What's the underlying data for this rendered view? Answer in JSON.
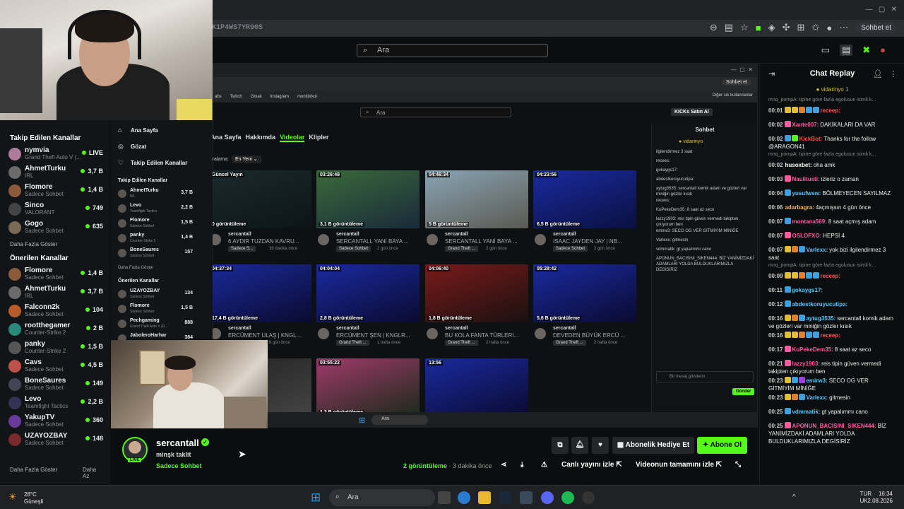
{
  "browser": {
    "url": "K1P4WS7YR90S",
    "chat_button": "Sohbet et"
  },
  "header": {
    "search_placeholder": "Ara"
  },
  "sidebar": {
    "followed_title": "Takip Edilen Kanallar",
    "followed": [
      {
        "name": "nymvia",
        "category": "Grand Theft Auto V (...",
        "viewers": "LIVE",
        "color": "#b07a9a"
      },
      {
        "name": "AhmetTurku",
        "category": "IRL",
        "viewers": "3,7 B",
        "color": "#6a6a6a"
      },
      {
        "name": "Flomore",
        "category": "Sadece Sohbet",
        "viewers": "1,4 B",
        "color": "#8a5a3a"
      },
      {
        "name": "Sinco",
        "category": "VALORANT",
        "viewers": "749",
        "color": "#444"
      },
      {
        "name": "Gogo",
        "category": "Sadece Sohbet",
        "viewers": "635",
        "color": "#7a6a55"
      }
    ],
    "followed_more": "Daha Fazla Göster",
    "recommended_title": "Önerilen Kanallar",
    "recommended": [
      {
        "name": "Flomore",
        "category": "Sadece Sohbet",
        "viewers": "1,4 B",
        "color": "#8a5a3a"
      },
      {
        "name": "AhmetTurku",
        "category": "IRL",
        "viewers": "3,7 B",
        "color": "#6a6a6a"
      },
      {
        "name": "Falconn2k",
        "category": "Sadece Sohbet",
        "viewers": "104",
        "color": "#b85a2a"
      },
      {
        "name": "rootthegamer",
        "category": "Counter-Strike 2",
        "viewers": "2 B",
        "color": "#2a8a7a"
      },
      {
        "name": "panky",
        "category": "Counter-Strike 2",
        "viewers": "1,5 B",
        "color": "#555"
      },
      {
        "name": "Cavs",
        "category": "Sadece Sohbet",
        "viewers": "4,5 B",
        "color": "#c0504a"
      },
      {
        "name": "BoneSaures",
        "category": "Sadece Sohbet",
        "viewers": "149",
        "color": "#445"
      },
      {
        "name": "Levo",
        "category": "Teamfight Tactics",
        "viewers": "2,2 B",
        "color": "#335"
      },
      {
        "name": "YakupTV",
        "category": "Sadece Sohbet",
        "viewers": "360",
        "color": "#6a3a9a"
      },
      {
        "name": "UZAYOZBAY",
        "category": "Sadece Sohbet",
        "viewers": "148",
        "color": "#7a2a2a"
      }
    ],
    "more": "Daha Fazla Göster",
    "less": "Daha Az"
  },
  "inner": {
    "nav": [
      "Ana Sayfa",
      "Gözat",
      "Takip Edilen Kanallar"
    ],
    "followed_title": "Takip Edilen Kanallar",
    "followed": [
      {
        "name": "AhmetTurku",
        "category": "IRL",
        "viewers": "3,7 B"
      },
      {
        "name": "Levo",
        "category": "Teamfight Tactics",
        "viewers": "2,2 B"
      },
      {
        "name": "Flomore",
        "category": "Sadece Sohbet",
        "viewers": "1,5 B"
      },
      {
        "name": "panky",
        "category": "Counter-Strike 2",
        "viewers": "1,4 B"
      },
      {
        "name": "BoneSaures",
        "category": "Sadece Sohbet",
        "viewers": "157"
      }
    ],
    "followed_more": "Daha Fazla Göster",
    "recommended_title": "Önerilen Kanallar",
    "recommended": [
      {
        "name": "UZAYOZBAY",
        "category": "Sadece Sohbet",
        "viewers": "134"
      },
      {
        "name": "Flomore",
        "category": "Sadece Sohbet",
        "viewers": "1,5 B"
      },
      {
        "name": "Pechgaming",
        "category": "Grand Theft Auto V (R...",
        "viewers": "888"
      },
      {
        "name": "JaboleroHarhar",
        "category": "",
        "viewers": "384"
      }
    ],
    "bookmarks": [
      "abs",
      "Twitch",
      "Gmail",
      "Instagram",
      "monitörkol"
    ],
    "other_bookmarks": "Diğer sık kullanılanlar",
    "search_placeholder": "Ara",
    "buy_kicks": "KICKs Satın Al",
    "tabs": [
      "Ana Sayfa",
      "Hakkımda",
      "Videolar",
      "Klipler"
    ],
    "sort_label": "Sıralama:",
    "sort_value": "En Yeni",
    "videos": [
      {
        "duration": "Güncel Yayın",
        "views": "0 görüntüleme",
        "channel": "sercantall",
        "title": "6 AYDIR TUZDAN KAVRU...",
        "tag": "Sadece S...",
        "ago": "38 dakika önce",
        "c1": "#1a2a2e",
        "c2": "#0d1417"
      },
      {
        "duration": "03:26:48",
        "views": "3,1 B görüntüleme",
        "channel": "sercantall",
        "title": "SERCANTALL YANİ BAYA ...",
        "tag": "Sadece Sohbet",
        "ago": "2 gün önce",
        "c1": "#3a6a3a",
        "c2": "#1a2a3a"
      },
      {
        "duration": "04:46:34",
        "views": "5 B görüntüleme",
        "channel": "sercantall",
        "title": "SERCANTALL YANİ BAYA ...",
        "tag": "Grand Theft ...",
        "ago": "2 gün önce",
        "c1": "#8aa4b4",
        "c2": "#5a5a52"
      },
      {
        "duration": "04:23:56",
        "views": "6,5 B görüntüleme",
        "channel": "sercantall",
        "title": "ISAAC JAYDEN JAY | NB...",
        "tag": "Sadece Sohbet",
        "ago": "2 gün önce",
        "c1": "#1a2aa0",
        "c2": "#0a1040"
      },
      {
        "duration": "04:37:34",
        "views": "17,4 B görüntüleme",
        "channel": "sercantall",
        "title": "ERCÜMENT ULAŞ | KNGL...",
        "tag": "",
        "ago": "6 gün önce",
        "c1": "#1a2a9a",
        "c2": "#0a0a30"
      },
      {
        "duration": "04:04:04",
        "views": "2,8 B görüntüleme",
        "channel": "sercantall",
        "title": "ERCÜMENT ŞEN | KNGLR...",
        "tag": "Grand Theft ...",
        "ago": "1 hafta önce",
        "c1": "#1a2aa0",
        "c2": "#0a0a30"
      },
      {
        "duration": "04:06:40",
        "views": "1,8 B görüntüleme",
        "channel": "sercantall",
        "title": "BU KOLA FANTA TÜRLERİ...",
        "tag": "Grand Theft ...",
        "ago": "2 hafta önce",
        "c1": "#7a1a1a",
        "c2": "#1a1010"
      },
      {
        "duration": "05:28:42",
        "views": "5,6 B görüntüleme",
        "channel": "sercantall",
        "title": "DEVEDEN BÜYÜK ERCÜ ...",
        "tag": "Grand Theft ...",
        "ago": "2 hafta önce",
        "c1": "#1a2aa0",
        "c2": "#0a0a30"
      },
      {
        "duration": "",
        "views": "",
        "channel": "",
        "title": "",
        "tag": "",
        "ago": "",
        "c1": "#222",
        "c2": "#444"
      },
      {
        "duration": "03:55:22",
        "views": "1,3 B görüntüleme",
        "channel": "",
        "title": "",
        "tag": "",
        "ago": "",
        "c1": "#a03a6a",
        "c2": "#1a2a1a"
      },
      {
        "duration": "13:56",
        "views": "",
        "channel": "",
        "title": "",
        "tag": "",
        "ago": "",
        "c1": "#1a2aa0",
        "c2": "#0a0a30"
      }
    ],
    "chat_title": "Sohbet",
    "chat_top_user": "vidarinyo",
    "chat_lines": [
      "ilgilendirmez 3 saat",
      "recees:",
      "gokaygs17:",
      "abdestkoruyucutipa:",
      "aytug3535: sercantall komik adam ve gözleri var miniğin gözler kısık",
      "recees:",
      "KuPekeDem35: 8 saat az seco",
      "lazzy1903: reis tipin güven vermedi takipten çıkıyorum ben",
      "emirw3: SECO OG VER GİTMİYİM MİNİĞE",
      "Varlexx: gitmesin",
      "vdmmatik: gt yapalımmı cano",
      "APONUN_BACISINI_SIKEN444: BİZ YANİMİZDAKİ ADAMLARI YOLDA BULDUKLARIMIZLA DEGİSİRİZ"
    ],
    "chat_input": "Bir mesaj gönderin",
    "send": "Gönder",
    "taskbar_search": "Ara"
  },
  "stream": {
    "name": "sercantall",
    "title": "minşk taklit",
    "category": "Sadece Sohbet",
    "live": "LIVE",
    "gift_sub": "Abonelik Hediye Et",
    "subscribe": "Abone Ol",
    "views": "2 görüntüleme",
    "ago": "· 3 dakika önce",
    "watch_live": "Canlı yayını izle",
    "watch_full": "Videonun tamamını izle"
  },
  "chat": {
    "title": "Chat Replay",
    "top_user": "vidarinyo",
    "top_badge": "1",
    "messages": [
      {
        "sys": "mnq_pompA: tipine göre fazla egolusun isimli k..."
      },
      {
        "t": "00:01",
        "u": "receep:",
        "uc": "#ff5a5a",
        "m": "",
        "badges": [
          "#e0c030",
          "#e0c030",
          "#e08030",
          "#3aa0e0",
          "#3aa0e0"
        ]
      },
      {
        "t": "00:02",
        "u": "Xante007:",
        "uc": "#ff5aa0",
        "m": "DAKİKALARI DA VAR",
        "badges": [
          "#ff5aa0"
        ]
      },
      {
        "t": "00:02",
        "u": "KickBot:",
        "uc": "#ff4a4a",
        "m": "Thanks for the follow @ARAGON41",
        "badges": [
          "#3aa0e0",
          "#53fc18"
        ]
      },
      {
        "sys": "mnq_pompA: tipine göre fazla egolusun isimli k..."
      },
      {
        "t": "00:02",
        "u": "husoxbet:",
        "uc": "#ffffff",
        "m": "oha amk",
        "badges": []
      },
      {
        "t": "00:03",
        "u": "Naulitusti:",
        "uc": "#ff5aa0",
        "m": "izleriz o zaman",
        "badges": [
          "#ff5aa0"
        ]
      },
      {
        "t": "00:04",
        "u": "yusufwsw:",
        "uc": "#5ac8ff",
        "m": "BÖLMEYECEN SAYILMAZ",
        "badges": [
          "#3aa0e0"
        ]
      },
      {
        "t": "00:06",
        "u": "adarbagra:",
        "uc": "#ffb45a",
        "m": "4açmışsın 4 gün önce",
        "badges": []
      },
      {
        "t": "00:07",
        "u": "montana569:",
        "uc": "#ff5aa0",
        "m": "8 saat açmış adam",
        "badges": [
          "#3aa0e0"
        ]
      },
      {
        "t": "00:07",
        "u": "OSLOFXO:",
        "uc": "#ff5aa0",
        "m": "HEPSİ 4",
        "badges": [
          "#ff5aa0"
        ]
      },
      {
        "t": "00:07",
        "u": "Varlexx:",
        "uc": "#5ac8ff",
        "m": "yok bizi ilgilendirmez 3 saat",
        "badges": [
          "#e0c030",
          "#e08030",
          "#3aa0e0"
        ]
      },
      {
        "sys": "mnq_pompA: tipine göre fazla egolusun isimli k..."
      },
      {
        "t": "00:09",
        "u": "receep:",
        "uc": "#ff5a5a",
        "m": "",
        "badges": [
          "#e0c030",
          "#e0c030",
          "#e08030",
          "#3aa0e0",
          "#3aa0e0"
        ]
      },
      {
        "t": "00:11",
        "u": "gokaygs17:",
        "uc": "#5ac8ff",
        "m": "",
        "badges": [
          "#3aa0e0"
        ]
      },
      {
        "t": "00:12",
        "u": "abdestkoruyucutipa:",
        "uc": "#5ac8ff",
        "m": "",
        "badges": [
          "#3aa0e0"
        ]
      },
      {
        "t": "00:16",
        "u": "aytug3535:",
        "uc": "#5ac8ff",
        "m": "sercantall komik adam ve gözleri var miniğin gözler kısık",
        "badges": [
          "#e0c030",
          "#e08030",
          "#3aa0e0"
        ]
      },
      {
        "t": "00:16",
        "u": "receep:",
        "uc": "#ff5a5a",
        "m": "",
        "badges": [
          "#e0c030",
          "#e0c030",
          "#e08030",
          "#3aa0e0",
          "#3aa0e0"
        ]
      },
      {
        "t": "00:17",
        "u": "KuPekeDem35:",
        "uc": "#ff5aa0",
        "m": "8 saat az seco",
        "badges": [
          "#ff5aa0"
        ]
      },
      {
        "t": "00:21",
        "u": "lazzy1903:",
        "uc": "#ff5aa0",
        "m": "reis tipin güven vermedi takipten çıkıyorum ben",
        "badges": [
          "#ff5aa0"
        ]
      },
      {
        "t": "00:23",
        "u": "emirw3:",
        "uc": "#5ac8ff",
        "m": "SECO OG VER GİTMİYİM MİNİĞE",
        "badges": [
          "#e0c030",
          "#3aa0e0",
          "#a040e0"
        ]
      },
      {
        "t": "00:23",
        "u": "Varlexx:",
        "uc": "#5ac8ff",
        "m": "gitmesin",
        "badges": [
          "#e0c030",
          "#e08030",
          "#3aa0e0"
        ]
      },
      {
        "t": "00:25",
        "u": "vdmmatik:",
        "uc": "#5ac8ff",
        "m": "gt yapalımmı cano",
        "badges": [
          "#3aa0e0"
        ]
      },
      {
        "t": "00:25",
        "u": "APONUN_BACISINI_SIKEN444:",
        "uc": "#ff5aa0",
        "m": "BİZ YANİMİZDAKİ ADAMLARI YOLDA BULDUKLARIMIZLA DEGİSİRİZ",
        "badges": [
          "#ff5aa0"
        ]
      }
    ]
  },
  "taskbar": {
    "temp": "28°C",
    "weather": "Güneşli",
    "search": "Ara",
    "lang1": "TUR",
    "lang2": "UK",
    "time": "16:34",
    "date": "2.08.2026"
  },
  "colors": {
    "accent": "#53fc18",
    "bg": "#0b0e0f",
    "panel": "#111517"
  }
}
